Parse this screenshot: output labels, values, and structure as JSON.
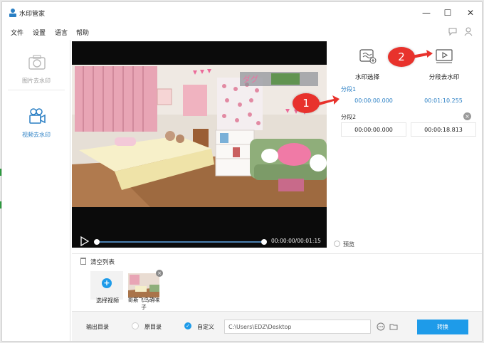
{
  "app": {
    "title": "水印管家"
  },
  "menu": [
    "文件",
    "设置",
    "语言",
    "帮助"
  ],
  "sidebar": [
    {
      "label": "图片去水印",
      "active": false,
      "icon": "camera-icon"
    },
    {
      "label": "视频去水印",
      "active": true,
      "icon": "video-camera-icon"
    }
  ],
  "player": {
    "time": "00:00:00/00:01:15",
    "progress": 0
  },
  "tools": [
    {
      "label": "水印选择",
      "icon": "watermark-select-icon"
    },
    {
      "label": "分段去水印",
      "icon": "segment-play-icon"
    }
  ],
  "segments": [
    {
      "label": "分段1",
      "start": "00:00:00.000",
      "end": "00:01:10.255",
      "active": true
    },
    {
      "label": "分段2",
      "start": "00:00:00.000",
      "end": "00:00:18.813",
      "active": false
    }
  ],
  "preview": {
    "label": "预览"
  },
  "list": {
    "clear_label": "清空列表",
    "add_label": "选择视频",
    "items": [
      {
        "name": "哥斯飞鸟萌味子"
      }
    ]
  },
  "output": {
    "label": "输出目录",
    "option_original": "原目录",
    "option_custom": "自定义",
    "path": "C:\\Users\\EDZ\\Desktop",
    "convert_label": "转换"
  },
  "annotations": [
    "1",
    "2"
  ],
  "colors": {
    "accent": "#1e9be9",
    "annotation": "#e8322c",
    "segment_active_text": "#2a7fc4"
  }
}
